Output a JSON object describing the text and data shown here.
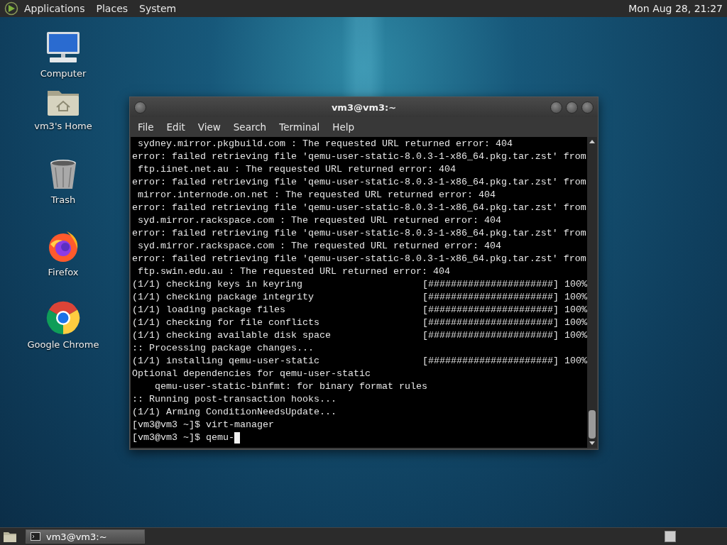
{
  "top_panel": {
    "menus": [
      "Applications",
      "Places",
      "System"
    ],
    "clock": "Mon Aug 28, 21:27"
  },
  "desktop_icons": [
    {
      "kind": "computer",
      "label": "Computer"
    },
    {
      "kind": "home",
      "label": "vm3's Home"
    },
    {
      "kind": "trash",
      "label": "Trash"
    },
    {
      "kind": "firefox",
      "label": "Firefox"
    },
    {
      "kind": "chrome",
      "label": "Google Chrome"
    }
  ],
  "window": {
    "title": "vm3@vm3:~",
    "menu": [
      "File",
      "Edit",
      "View",
      "Search",
      "Terminal",
      "Help"
    ],
    "lines": [
      {
        "kind": "text",
        "text": " sydney.mirror.pkgbuild.com : The requested URL returned error: 404"
      },
      {
        "kind": "text",
        "text": "error: failed retrieving file 'qemu-user-static-8.0.3-1-x86_64.pkg.tar.zst' from"
      },
      {
        "kind": "text",
        "text": " ftp.iinet.net.au : The requested URL returned error: 404"
      },
      {
        "kind": "text",
        "text": "error: failed retrieving file 'qemu-user-static-8.0.3-1-x86_64.pkg.tar.zst' from"
      },
      {
        "kind": "text",
        "text": " mirror.internode.on.net : The requested URL returned error: 404"
      },
      {
        "kind": "text",
        "text": "error: failed retrieving file 'qemu-user-static-8.0.3-1-x86_64.pkg.tar.zst' from"
      },
      {
        "kind": "text",
        "text": " syd.mirror.rackspace.com : The requested URL returned error: 404"
      },
      {
        "kind": "text",
        "text": "error: failed retrieving file 'qemu-user-static-8.0.3-1-x86_64.pkg.tar.zst' from"
      },
      {
        "kind": "text",
        "text": " syd.mirror.rackspace.com : The requested URL returned error: 404"
      },
      {
        "kind": "text",
        "text": "error: failed retrieving file 'qemu-user-static-8.0.3-1-x86_64.pkg.tar.zst' from"
      },
      {
        "kind": "text",
        "text": " ftp.swin.edu.au : The requested URL returned error: 404"
      },
      {
        "kind": "progress",
        "text": "(1/1) checking keys in keyring",
        "bar": "[######################]",
        "percent": "100%"
      },
      {
        "kind": "progress",
        "text": "(1/1) checking package integrity",
        "bar": "[######################]",
        "percent": "100%"
      },
      {
        "kind": "progress",
        "text": "(1/1) loading package files",
        "bar": "[######################]",
        "percent": "100%"
      },
      {
        "kind": "progress",
        "text": "(1/1) checking for file conflicts",
        "bar": "[######################]",
        "percent": "100%"
      },
      {
        "kind": "progress",
        "text": "(1/1) checking available disk space",
        "bar": "[######################]",
        "percent": "100%"
      },
      {
        "kind": "text",
        "text": ":: Processing package changes..."
      },
      {
        "kind": "progress",
        "text": "(1/1) installing qemu-user-static",
        "bar": "[######################]",
        "percent": "100%"
      },
      {
        "kind": "text",
        "text": "Optional dependencies for qemu-user-static"
      },
      {
        "kind": "text",
        "text": "    qemu-user-static-binfmt: for binary format rules"
      },
      {
        "kind": "text",
        "text": ":: Running post-transaction hooks..."
      },
      {
        "kind": "text",
        "text": "(1/1) Arming ConditionNeedsUpdate..."
      },
      {
        "kind": "text",
        "text": "[vm3@vm3 ~]$ virt-manager"
      },
      {
        "kind": "prompt",
        "text": "[vm3@vm3 ~]$ qemu-"
      }
    ]
  },
  "taskbar": {
    "tasks": [
      {
        "label": "vm3@vm3:~",
        "selected": true
      }
    ]
  }
}
